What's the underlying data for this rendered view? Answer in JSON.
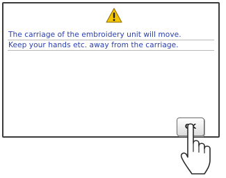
{
  "dialog": {
    "icon": "warning-icon",
    "message_line_1": "The carriage of the embroidery unit will move.",
    "message_line_2": "Keep your hands etc. away from the carriage.",
    "ok_label": "OK"
  },
  "pointer": {
    "icon": "pointing-hand-icon"
  },
  "colors": {
    "message_text": "#2a3fb0",
    "warning_fill": "#f5c400",
    "border": "#3a3a3a"
  }
}
